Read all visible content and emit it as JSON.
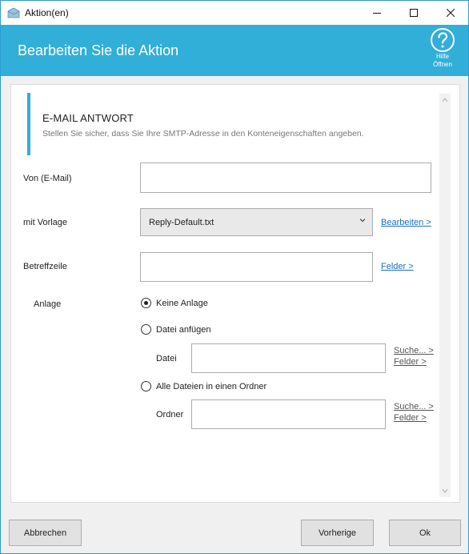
{
  "window": {
    "title": "Aktion(en)"
  },
  "header": {
    "title": "Bearbeiten Sie die Aktion",
    "help_line1": "Hilfe",
    "help_line2": "Öffnen"
  },
  "section": {
    "title": "E-MAIL ANTWORT",
    "description": "Stellen Sie sicher, dass Sie Ihre SMTP-Adresse in den Konteneigenschaften angeben."
  },
  "form": {
    "from_label": "Von (E-Mail)",
    "from_value": "",
    "template_label": "mit Vorlage",
    "template_value": "Reply-Default.txt",
    "template_edit_link": "Bearbeiten >",
    "subject_label": "Betreffzeile",
    "subject_value": "",
    "subject_fields_link": "Felder >",
    "attachment_label": "Anlage",
    "options": [
      {
        "label": "Keine Anlage",
        "selected": true
      },
      {
        "label": "Datei anfügen",
        "selected": false
      },
      {
        "label": "Alle Dateien in einen Ordner",
        "selected": false
      }
    ],
    "file_label": "Datei",
    "file_value": "",
    "file_search_link": "Suche... >",
    "file_fields_link": "Felder >",
    "folder_label": "Ordner",
    "folder_value": "",
    "folder_search_link": "Suche... >",
    "folder_fields_link": "Felder >"
  },
  "buttons": {
    "cancel": "Abbrechen",
    "previous": "Vorherige",
    "ok": "Ok"
  },
  "colors": {
    "accent": "#31afd9",
    "link": "#1a6fc9"
  },
  "icons": {
    "app": "envelope-icon",
    "help": "question-circle-icon"
  }
}
